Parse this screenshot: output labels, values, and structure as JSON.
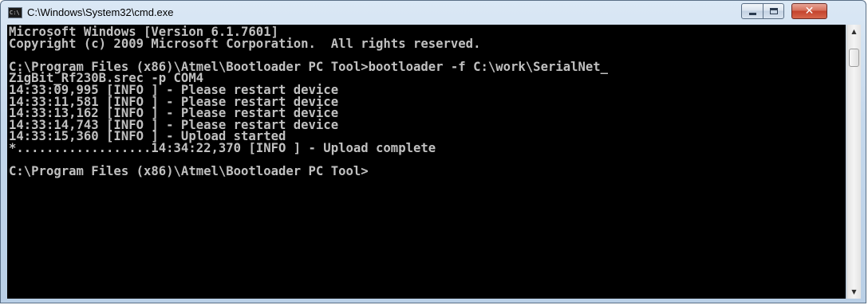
{
  "window": {
    "title": "C:\\Windows\\System32\\cmd.exe",
    "icon": "cmd-icon",
    "icon_text": "C:\\"
  },
  "controls": {
    "minimize": "minimize-icon",
    "maximize": "maximize-icon",
    "close": "close-icon",
    "close_glyph": "✕"
  },
  "console": {
    "lines": [
      "Microsoft Windows [Version 6.1.7601]",
      "Copyright (c) 2009 Microsoft Corporation.  All rights reserved.",
      "",
      "C:\\Program Files (x86)\\Atmel\\Bootloader PC Tool>bootloader -f C:\\work\\SerialNet_",
      "ZigBit_Rf230B.srec -p COM4",
      "14:33:09,995 [INFO ] - Please restart device",
      "14:33:11,581 [INFO ] - Please restart device",
      "14:33:13,162 [INFO ] - Please restart device",
      "14:33:14,743 [INFO ] - Please restart device",
      "14:33:15,360 [INFO ] - Upload started",
      "*..................14:34:22,370 [INFO ] - Upload complete",
      "",
      "C:\\Program Files (x86)\\Atmel\\Bootloader PC Tool>"
    ]
  },
  "scrollbar": {
    "up_glyph": "▲",
    "down_glyph": "▼"
  }
}
